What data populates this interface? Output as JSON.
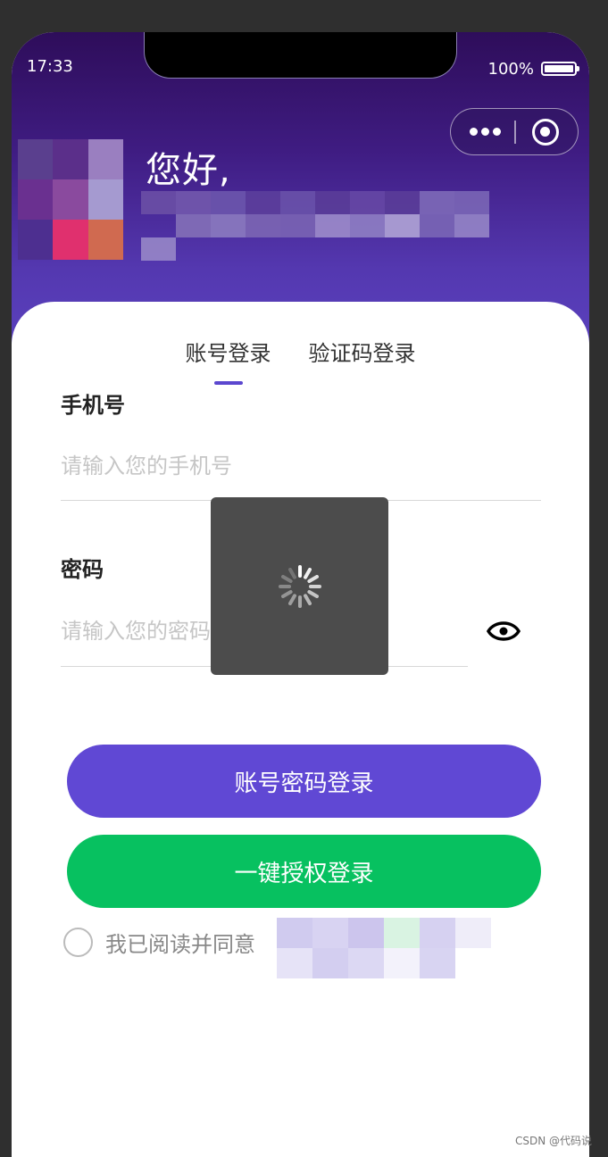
{
  "status_bar": {
    "time": "17:33",
    "battery": "100%"
  },
  "header": {
    "greeting": "您好,"
  },
  "tabs": [
    {
      "label": "账号登录",
      "active": true
    },
    {
      "label": "验证码登录",
      "active": false
    }
  ],
  "form": {
    "phone": {
      "label": "手机号",
      "placeholder": "请输入您的手机号",
      "value": ""
    },
    "password": {
      "label": "密码",
      "placeholder": "请输入您的密码",
      "value": ""
    }
  },
  "buttons": {
    "account_login": "账号密码登录",
    "quick_login": "一键授权登录"
  },
  "agreement": {
    "text": "我已阅读并同意",
    "checked": false
  },
  "loading": {
    "visible": true
  },
  "watermark": "CSDN @代码说",
  "colors": {
    "primary": "#6048d4",
    "wechat_green": "#07c160",
    "header_top": "#2e0d5a",
    "header_bottom": "#5c44c2",
    "toast_bg": "#4c4c4c"
  },
  "icons": [
    "more-icon",
    "close-capsule-icon",
    "eye-icon",
    "loading-spinner-icon",
    "battery-icon"
  ]
}
